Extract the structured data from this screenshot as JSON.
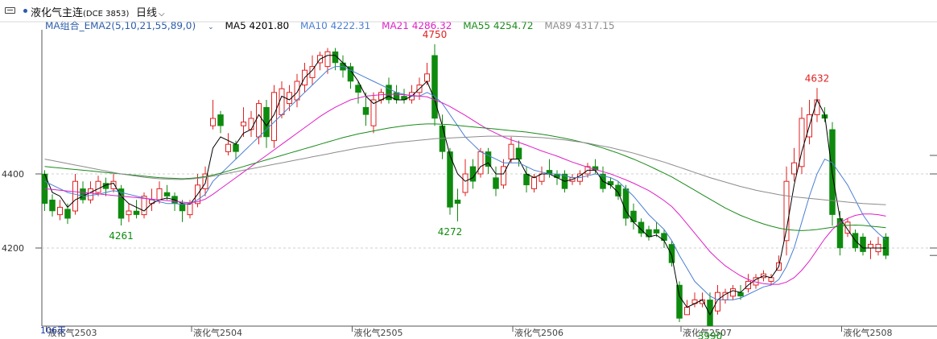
{
  "header": {
    "title": "液化气主连",
    "code": "(DCE 3853)",
    "period": "日线"
  },
  "legend": {
    "indicator": "MA组合_EMA2(5,10,21,55,89,0)",
    "items": [
      {
        "label": "MA5 4201.80",
        "color": "#000000"
      },
      {
        "label": "MA10 4222.31",
        "color": "#4a7fd4"
      },
      {
        "label": "MA21 4286.32",
        "color": "#e01ec8"
      },
      {
        "label": "MA55 4254.72",
        "color": "#1a8a1a"
      },
      {
        "label": "MA89 4317.15",
        "color": "#8c8c8c"
      }
    ]
  },
  "colors": {
    "up": "#e02020",
    "down": "#0e8a0e",
    "annotation": "#e02020",
    "annotation_low": "#0e8a0e",
    "axis": "#333333"
  },
  "chart_data": {
    "type": "candlestick",
    "bar_count_label": "106天",
    "y_ticks": [
      4400,
      4200
    ],
    "ylim": [
      3950,
      4800
    ],
    "x_tick_labels": [
      {
        "label": "液化气2503",
        "index": 0
      },
      {
        "label": "液化气2504",
        "index": 19
      },
      {
        "label": "液化气2505",
        "index": 40
      },
      {
        "label": "液化气2506",
        "index": 61
      },
      {
        "label": "液化气2507",
        "index": 83
      },
      {
        "label": "液化气2508",
        "index": 104
      }
    ],
    "annotations": [
      {
        "label": "4261",
        "index": 10,
        "value": 4261,
        "kind": "low"
      },
      {
        "label": "4750",
        "index": 51,
        "value": 4750,
        "kind": "high"
      },
      {
        "label": "4272",
        "index": 53,
        "value": 4272,
        "kind": "low"
      },
      {
        "label": "3990",
        "index": 87,
        "value": 3990,
        "kind": "low"
      },
      {
        "label": "4632",
        "index": 101,
        "value": 4632,
        "kind": "high"
      }
    ],
    "candles": [
      [
        4400,
        4320,
        4410,
        4300
      ],
      [
        4330,
        4300,
        4345,
        4285
      ],
      [
        4290,
        4310,
        4330,
        4275
      ],
      [
        4305,
        4280,
        4320,
        4265
      ],
      [
        4300,
        4380,
        4400,
        4290
      ],
      [
        4360,
        4330,
        4380,
        4320
      ],
      [
        4330,
        4360,
        4380,
        4320
      ],
      [
        4350,
        4380,
        4395,
        4340
      ],
      [
        4375,
        4360,
        4390,
        4340
      ],
      [
        4360,
        4380,
        4400,
        4350
      ],
      [
        4360,
        4280,
        4370,
        4261
      ],
      [
        4290,
        4300,
        4320,
        4270
      ],
      [
        4300,
        4290,
        4330,
        4280
      ],
      [
        4290,
        4340,
        4350,
        4280
      ],
      [
        4320,
        4330,
        4360,
        4300
      ],
      [
        4330,
        4360,
        4380,
        4320
      ],
      [
        4350,
        4340,
        4370,
        4330
      ],
      [
        4340,
        4320,
        4350,
        4300
      ],
      [
        4320,
        4300,
        4330,
        4270
      ],
      [
        4290,
        4320,
        4330,
        4280
      ],
      [
        4320,
        4370,
        4400,
        4310
      ],
      [
        4360,
        4400,
        4420,
        4340
      ],
      [
        4530,
        4550,
        4600,
        4520
      ],
      [
        4560,
        4530,
        4570,
        4510
      ],
      [
        4460,
        4480,
        4510,
        4450
      ],
      [
        4480,
        4460,
        4490,
        4440
      ],
      [
        4530,
        4540,
        4580,
        4500
      ],
      [
        4520,
        4550,
        4570,
        4500
      ],
      [
        4500,
        4590,
        4600,
        4480
      ],
      [
        4580,
        4500,
        4600,
        4470
      ],
      [
        4490,
        4620,
        4640,
        4470
      ],
      [
        4560,
        4630,
        4650,
        4550
      ],
      [
        4590,
        4620,
        4640,
        4570
      ],
      [
        4600,
        4650,
        4670,
        4580
      ],
      [
        4640,
        4680,
        4700,
        4620
      ],
      [
        4660,
        4690,
        4720,
        4640
      ],
      [
        4700,
        4720,
        4730,
        4680
      ],
      [
        4690,
        4730,
        4740,
        4670
      ],
      [
        4730,
        4700,
        4740,
        4680
      ],
      [
        4700,
        4680,
        4720,
        4660
      ],
      [
        4690,
        4650,
        4700,
        4630
      ],
      [
        4640,
        4620,
        4650,
        4590
      ],
      [
        4580,
        4560,
        4620,
        4530
      ],
      [
        4530,
        4600,
        4620,
        4510
      ],
      [
        4600,
        4620,
        4630,
        4590
      ],
      [
        4640,
        4600,
        4660,
        4590
      ],
      [
        4620,
        4600,
        4640,
        4590
      ],
      [
        4610,
        4600,
        4630,
        4590
      ],
      [
        4600,
        4620,
        4640,
        4590
      ],
      [
        4620,
        4640,
        4660,
        4600
      ],
      [
        4650,
        4670,
        4700,
        4640
      ],
      [
        4720,
        4550,
        4750,
        4530
      ],
      [
        4530,
        4460,
        4560,
        4440
      ],
      [
        4460,
        4310,
        4470,
        4290
      ],
      [
        4330,
        4320,
        4360,
        4272
      ],
      [
        4350,
        4400,
        4440,
        4340
      ],
      [
        4420,
        4380,
        4440,
        4360
      ],
      [
        4400,
        4460,
        4470,
        4390
      ],
      [
        4460,
        4420,
        4470,
        4400
      ],
      [
        4390,
        4360,
        4420,
        4340
      ],
      [
        4370,
        4420,
        4440,
        4360
      ],
      [
        4440,
        4480,
        4500,
        4430
      ],
      [
        4470,
        4440,
        4490,
        4420
      ],
      [
        4400,
        4370,
        4420,
        4350
      ],
      [
        4360,
        4390,
        4400,
        4350
      ],
      [
        4380,
        4400,
        4420,
        4370
      ],
      [
        4410,
        4400,
        4440,
        4390
      ],
      [
        4400,
        4390,
        4410,
        4370
      ],
      [
        4400,
        4360,
        4410,
        4350
      ],
      [
        4380,
        4390,
        4400,
        4370
      ],
      [
        4380,
        4400,
        4410,
        4370
      ],
      [
        4400,
        4420,
        4430,
        4390
      ],
      [
        4420,
        4410,
        4440,
        4400
      ],
      [
        4400,
        4360,
        4420,
        4350
      ],
      [
        4380,
        4370,
        4390,
        4360
      ],
      [
        4370,
        4340,
        4380,
        4330
      ],
      [
        4360,
        4280,
        4370,
        4260
      ],
      [
        4300,
        4270,
        4320,
        4250
      ],
      [
        4270,
        4240,
        4280,
        4230
      ],
      [
        4250,
        4230,
        4260,
        4220
      ],
      [
        4250,
        4240,
        4270,
        4230
      ],
      [
        4240,
        4220,
        4250,
        4200
      ],
      [
        4210,
        4160,
        4220,
        4150
      ],
      [
        4100,
        4010,
        4110,
        4000
      ],
      [
        4020,
        4040,
        4060,
        4020
      ],
      [
        4050,
        4060,
        4080,
        4040
      ],
      [
        4050,
        4060,
        4080,
        4040
      ],
      [
        4060,
        3990,
        4080,
        3990
      ],
      [
        4030,
        4080,
        4100,
        4020
      ],
      [
        4060,
        4080,
        4090,
        4050
      ],
      [
        4070,
        4090,
        4100,
        4060
      ],
      [
        4080,
        4070,
        4100,
        4060
      ],
      [
        4090,
        4110,
        4130,
        4080
      ],
      [
        4100,
        4120,
        4130,
        4090
      ],
      [
        4120,
        4130,
        4140,
        4110
      ],
      [
        4110,
        4120,
        4130,
        4100
      ],
      [
        4140,
        4160,
        4180,
        4140
      ],
      [
        4220,
        4380,
        4420,
        4180
      ],
      [
        4400,
        4430,
        4470,
        4380
      ],
      [
        4420,
        4550,
        4580,
        4400
      ],
      [
        4500,
        4560,
        4600,
        4480
      ],
      [
        4560,
        4600,
        4632,
        4540
      ],
      [
        4560,
        4550,
        4580,
        4540
      ],
      [
        4520,
        4290,
        4540,
        4260
      ],
      [
        4280,
        4200,
        4300,
        4180
      ],
      [
        4240,
        4270,
        4280,
        4230
      ],
      [
        4240,
        4200,
        4250,
        4190
      ],
      [
        4230,
        4190,
        4240,
        4180
      ],
      [
        4200,
        4210,
        4220,
        4170
      ],
      [
        4190,
        4210,
        4230,
        4180
      ],
      [
        4230,
        4180,
        4240,
        4170
      ]
    ],
    "series": [
      {
        "name": "MA5",
        "color": "#000000",
        "values": [
          4400,
          4350,
          4340,
          4310,
          4330,
          4340,
          4350,
          4360,
          4370,
          4375,
          4340,
          4320,
          4310,
          4300,
          4320,
          4330,
          4335,
          4330,
          4320,
          4318,
          4345,
          4375,
          4470,
          4500,
          4490,
          4480,
          4510,
          4520,
          4560,
          4530,
          4560,
          4610,
          4600,
          4620,
          4660,
          4680,
          4710,
          4720,
          4720,
          4700,
          4680,
          4650,
          4610,
          4590,
          4600,
          4610,
          4600,
          4600,
          4610,
          4630,
          4650,
          4600,
          4530,
          4450,
          4400,
          4380,
          4390,
          4420,
          4430,
          4400,
          4400,
          4440,
          4440,
          4400,
          4390,
          4400,
          4400,
          4390,
          4380,
          4385,
          4395,
          4410,
          4410,
          4380,
          4370,
          4350,
          4300,
          4270,
          4250,
          4230,
          4235,
          4220,
          4180,
          4070,
          4040,
          4050,
          4060,
          4020,
          4060,
          4075,
          4085,
          4080,
          4100,
          4115,
          4125,
          4120,
          4150,
          4250,
          4370,
          4460,
          4530,
          4600,
          4560,
          4400,
          4280,
          4250,
          4220,
          4200,
          4200,
          4200,
          4200
        ]
      },
      {
        "name": "MA10",
        "color": "#4a7fd4",
        "values": [
          4380,
          4370,
          4360,
          4350,
          4345,
          4340,
          4342,
          4345,
          4350,
          4355,
          4350,
          4345,
          4340,
          4335,
          4330,
          4325,
          4320,
          4320,
          4318,
          4320,
          4330,
          4345,
          4380,
          4400,
          4420,
          4440,
          4460,
          4480,
          4500,
          4520,
          4540,
          4560,
          4580,
          4600,
          4620,
          4640,
          4660,
          4680,
          4690,
          4690,
          4680,
          4670,
          4660,
          4650,
          4640,
          4630,
          4620,
          4615,
          4610,
          4610,
          4620,
          4610,
          4590,
          4560,
          4530,
          4500,
          4480,
          4460,
          4450,
          4440,
          4430,
          4430,
          4430,
          4420,
          4410,
          4405,
          4400,
          4400,
          4395,
          4390,
          4390,
          4395,
          4400,
          4395,
          4390,
          4380,
          4360,
          4340,
          4315,
          4290,
          4270,
          4250,
          4220,
          4180,
          4145,
          4110,
          4090,
          4070,
          4060,
          4060,
          4060,
          4065,
          4075,
          4085,
          4095,
          4100,
          4115,
          4150,
          4200,
          4270,
          4340,
          4400,
          4440,
          4430,
          4400,
          4370,
          4330,
          4290,
          4260,
          4240,
          4222
        ]
      },
      {
        "name": "MA21",
        "color": "#e01ec8",
        "values": [
          4360,
          4358,
          4356,
          4354,
          4352,
          4350,
          4348,
          4346,
          4344,
          4342,
          4340,
          4338,
          4336,
          4334,
          4332,
          4330,
          4328,
          4326,
          4324,
          4322,
          4325,
          4332,
          4345,
          4360,
          4375,
          4390,
          4405,
          4420,
          4435,
          4450,
          4465,
          4480,
          4495,
          4510,
          4525,
          4540,
          4555,
          4568,
          4580,
          4590,
          4600,
          4605,
          4610,
          4612,
          4614,
          4615,
          4615,
          4614,
          4612,
          4610,
          4608,
          4600,
          4592,
          4582,
          4570,
          4558,
          4545,
          4532,
          4520,
          4510,
          4500,
          4492,
          4485,
          4478,
          4470,
          4462,
          4455,
          4448,
          4440,
          4432,
          4425,
          4418,
          4412,
          4406,
          4400,
          4392,
          4384,
          4375,
          4365,
          4355,
          4342,
          4328,
          4312,
          4290,
          4265,
          4240,
          4215,
          4190,
          4170,
          4152,
          4138,
          4125,
          4115,
          4108,
          4104,
          4102,
          4102,
          4108,
          4120,
          4140,
          4165,
          4195,
          4225,
          4250,
          4268,
          4280,
          4288,
          4292,
          4292,
          4290,
          4286
        ]
      },
      {
        "name": "MA55",
        "color": "#1a8a1a",
        "values": [
          4420,
          4418,
          4416,
          4414,
          4412,
          4410,
          4408,
          4406,
          4404,
          4402,
          4400,
          4398,
          4396,
          4394,
          4392,
          4390,
          4389,
          4388,
          4387,
          4388,
          4390,
          4393,
          4397,
          4402,
          4408,
          4414,
          4420,
          4426,
          4432,
          4438,
          4444,
          4450,
          4456,
          4462,
          4468,
          4474,
          4480,
          4486,
          4492,
          4498,
          4503,
          4508,
          4512,
          4516,
          4520,
          4524,
          4527,
          4530,
          4532,
          4534,
          4535,
          4535,
          4534,
          4533,
          4531,
          4529,
          4527,
          4525,
          4523,
          4521,
          4519,
          4517,
          4515,
          4513,
          4510,
          4507,
          4504,
          4500,
          4496,
          4492,
          4487,
          4482,
          4476,
          4470,
          4463,
          4456,
          4448,
          4440,
          4431,
          4422,
          4412,
          4402,
          4392,
          4380,
          4368,
          4356,
          4344,
          4332,
          4320,
          4308,
          4298,
          4288,
          4280,
          4272,
          4265,
          4259,
          4254,
          4250,
          4248,
          4247,
          4248,
          4250,
          4253,
          4256,
          4259,
          4261,
          4262,
          4261,
          4259,
          4257,
          4255
        ]
      },
      {
        "name": "MA89",
        "color": "#8c8c8c",
        "values": [
          4440,
          4436,
          4432,
          4428,
          4424,
          4420,
          4416,
          4412,
          4408,
          4404,
          4400,
          4397,
          4394,
          4391,
          4389,
          4387,
          4386,
          4385,
          4385,
          4386,
          4388,
          4391,
          4394,
          4398,
          4402,
          4406,
          4410,
          4414,
          4418,
          4422,
          4426,
          4430,
          4434,
          4438,
          4442,
          4446,
          4450,
          4454,
          4458,
          4462,
          4466,
          4470,
          4473,
          4476,
          4479,
          4482,
          4485,
          4487,
          4489,
          4491,
          4493,
          4495,
          4496,
          4497,
          4498,
          4499,
          4500,
          4501,
          4502,
          4502,
          4502,
          4502,
          4501,
          4500,
          4499,
          4498,
          4496,
          4494,
          4492,
          4489,
          4486,
          4483,
          4479,
          4475,
          4471,
          4466,
          4461,
          4456,
          4450,
          4444,
          4438,
          4432,
          4425,
          4418,
          4411,
          4404,
          4397,
          4390,
          4384,
          4378,
          4372,
          4366,
          4361,
          4356,
          4352,
          4348,
          4344,
          4341,
          4338,
          4336,
          4334,
          4332,
          4330,
          4328,
          4326,
          4324,
          4322,
          4320,
          4319,
          4318,
          4317
        ]
      }
    ]
  }
}
